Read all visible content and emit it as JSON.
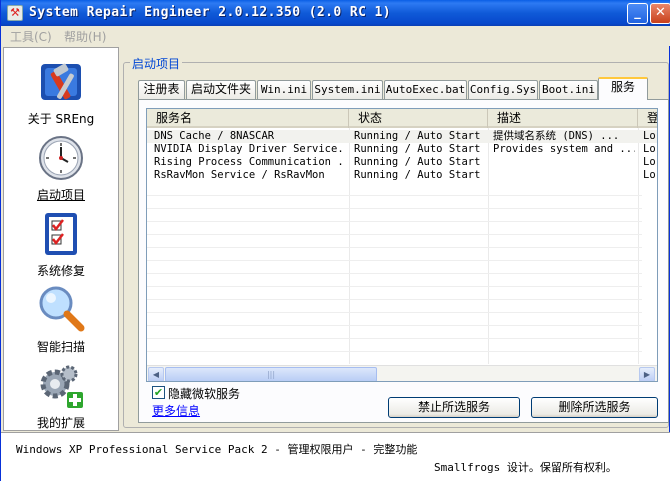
{
  "window": {
    "title": "System Repair Engineer 2.0.12.350 (2.0 RC 1)",
    "minimize_label": "_",
    "close_label": "✕"
  },
  "menu": [
    {
      "label": "工具(C)"
    },
    {
      "label": "帮助(H)"
    }
  ],
  "sidebar": {
    "items": [
      {
        "label": "关于 SREng",
        "icon": "tools-icon",
        "active": false
      },
      {
        "label": "启动项目",
        "icon": "clock-icon",
        "active": true
      },
      {
        "label": "系统修复",
        "icon": "checklist-icon",
        "active": false
      },
      {
        "label": "智能扫描",
        "icon": "magnifier-icon",
        "active": false
      },
      {
        "label": "我的扩展",
        "icon": "gear-plus-icon",
        "active": false
      }
    ]
  },
  "group": {
    "title": "启动项目"
  },
  "tabs": [
    {
      "label": "注册表"
    },
    {
      "label": "启动文件夹"
    },
    {
      "label": "Win.ini"
    },
    {
      "label": "System.ini"
    },
    {
      "label": "AutoExec.bat"
    },
    {
      "label": "Config.Sys"
    },
    {
      "label": "Boot.ini"
    },
    {
      "label": "服务"
    }
  ],
  "active_tab": "服务",
  "services_table": {
    "columns": [
      "服务名",
      "状态",
      "描述",
      "登"
    ],
    "rows": [
      [
        "DNS Cache / 8NASCAR",
        "Running / Auto Start",
        "提供域名系统 (DNS) ...",
        "Lo"
      ],
      [
        "NVIDIA Display Driver Service...",
        "Running / Auto Start",
        "Provides system and ...",
        "Lo"
      ],
      [
        "Rising Process Communication ...",
        "Running / Auto Start",
        "",
        "Lo"
      ],
      [
        "RsRavMon Service / RsRavMon",
        "Running / Auto Start",
        "",
        "Lo"
      ]
    ],
    "scroll_left": "◀",
    "scroll_right": "▶",
    "scroll_grip": "|||"
  },
  "hide_ms_services": {
    "label": "隐藏微软服务",
    "checked": true,
    "mark": "✔"
  },
  "more_info": "更多信息",
  "buttons": {
    "stop_selected": "禁止所选服务",
    "delete_selected": "删除所选服务"
  },
  "status": {
    "os_info": "Windows XP Professional Service Pack 2 - 管理权限用户 - 完整功能",
    "copyright": "Smallfrogs 设计。保留所有权利。"
  },
  "colors": {
    "titlebar": "#0a5ee5",
    "group_title": "#0046d5",
    "active_tab_accent": "#ffc83c",
    "link": "#0000ff"
  }
}
